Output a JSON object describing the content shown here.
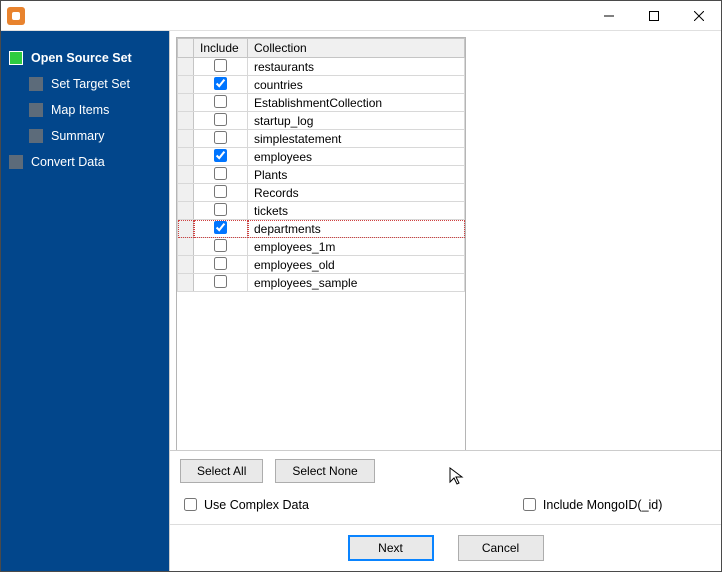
{
  "sidebar": {
    "items": [
      {
        "label": "Open Source Set",
        "active": true,
        "sub": false
      },
      {
        "label": "Set Target Set",
        "active": false,
        "sub": true
      },
      {
        "label": "Map Items",
        "active": false,
        "sub": true
      },
      {
        "label": "Summary",
        "active": false,
        "sub": true
      },
      {
        "label": "Convert Data",
        "active": false,
        "sub": false
      }
    ]
  },
  "table": {
    "headers": {
      "include": "Include",
      "collection": "Collection"
    },
    "rows": [
      {
        "include": false,
        "name": "restaurants",
        "selected": false
      },
      {
        "include": true,
        "name": "countries",
        "selected": false
      },
      {
        "include": false,
        "name": "EstablishmentCollection",
        "selected": false
      },
      {
        "include": false,
        "name": "startup_log",
        "selected": false
      },
      {
        "include": false,
        "name": "simplestatement",
        "selected": false
      },
      {
        "include": true,
        "name": "employees",
        "selected": false
      },
      {
        "include": false,
        "name": "Plants",
        "selected": false
      },
      {
        "include": false,
        "name": "Records",
        "selected": false
      },
      {
        "include": false,
        "name": "tickets",
        "selected": false
      },
      {
        "include": true,
        "name": "departments",
        "selected": true
      },
      {
        "include": false,
        "name": "employees_1m",
        "selected": false
      },
      {
        "include": false,
        "name": "employees_old",
        "selected": false
      },
      {
        "include": false,
        "name": "employees_sample",
        "selected": false
      }
    ]
  },
  "buttons": {
    "select_all": "Select All",
    "select_none": "Select None",
    "next": "Next",
    "cancel": "Cancel"
  },
  "options": {
    "use_complex_data": {
      "label": "Use Complex Data",
      "checked": false
    },
    "include_mongoid": {
      "label": "Include MongoID(_id)",
      "checked": false
    }
  }
}
